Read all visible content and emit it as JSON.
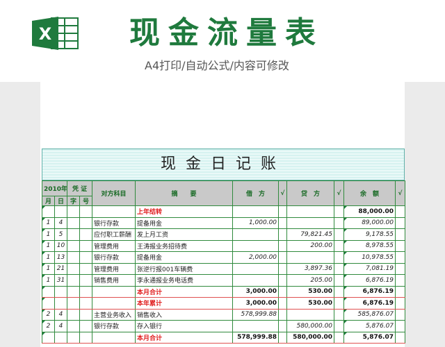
{
  "header": {
    "title": "现金流量表",
    "subtitle": "A4打印/自动公式/内容可修改",
    "logo_letter": "X"
  },
  "ledger": {
    "title": "现金日记账",
    "columns": {
      "year": "2010年",
      "voucher": "凭 证",
      "month": "月",
      "day": "日",
      "zi": "字",
      "hao": "号",
      "account": "对方科目",
      "summary": "摘　　要",
      "debit": "借　方",
      "credit": "贷　方",
      "check": "√",
      "balance": "余　额"
    },
    "rows": [
      {
        "month": "",
        "day": "",
        "account": "",
        "summary": "上年结转",
        "debit": "",
        "credit": "",
        "balance": "88,000.00",
        "type": "carry"
      },
      {
        "month": "1",
        "day": "4",
        "account": "银行存款",
        "summary": "提备用金",
        "debit": "1,000.00",
        "credit": "",
        "balance": "89,000.00",
        "type": "entry"
      },
      {
        "month": "1",
        "day": "5",
        "account": "应付职工薪酬",
        "summary": "发上月工资",
        "debit": "",
        "credit": "79,821.45",
        "balance": "9,178.55",
        "type": "entry"
      },
      {
        "month": "1",
        "day": "10",
        "account": "管理费用",
        "summary": "王涛报业务招待费",
        "debit": "",
        "credit": "200.00",
        "balance": "8,978.55",
        "type": "entry"
      },
      {
        "month": "1",
        "day": "13",
        "account": "银行存款",
        "summary": "提备用金",
        "debit": "2,000.00",
        "credit": "",
        "balance": "10,978.55",
        "type": "entry"
      },
      {
        "month": "1",
        "day": "21",
        "account": "管理费用",
        "summary": "张逆行报001车辆费",
        "debit": "",
        "credit": "3,897.36",
        "balance": "7,081.19",
        "type": "entry"
      },
      {
        "month": "1",
        "day": "31",
        "account": "销售费用",
        "summary": "李永通报业务电话费",
        "debit": "",
        "credit": "205.00",
        "balance": "6,876.19",
        "type": "entry"
      },
      {
        "month": "",
        "day": "",
        "account": "",
        "summary": "本月合计",
        "debit": "3,000.00",
        "credit": "530.00",
        "balance": "6,876.19",
        "type": "total"
      },
      {
        "month": "",
        "day": "",
        "account": "",
        "summary": "本年累计",
        "debit": "3,000.00",
        "credit": "530.00",
        "balance": "6,876.19",
        "type": "total"
      },
      {
        "month": "2",
        "day": "4",
        "account": "主营业务收入",
        "summary": "销售收入",
        "debit": "578,999.88",
        "credit": "",
        "balance": "585,876.07",
        "type": "entry"
      },
      {
        "month": "2",
        "day": "4",
        "account": "银行存款",
        "summary": "存入银行",
        "debit": "",
        "credit": "580,000.00",
        "balance": "5,876.07",
        "type": "entry"
      },
      {
        "month": "",
        "day": "",
        "account": "",
        "summary": "本月合计",
        "debit": "578,999.88",
        "credit": "580,000.00",
        "balance": "5,876.07",
        "type": "total"
      }
    ]
  },
  "colors": {
    "brand_green": "#1f7a3d",
    "grid_green": "#2f8a3c",
    "total_red": "#e02020"
  },
  "icons": {
    "logo": "excel-logo-icon"
  }
}
